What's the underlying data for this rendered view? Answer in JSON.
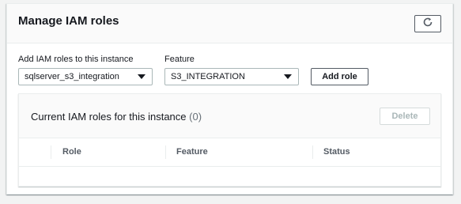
{
  "panel": {
    "title": "Manage IAM roles",
    "refresh_icon": "refresh-icon"
  },
  "form": {
    "role_label": "Add IAM roles to this instance",
    "role_value": "sqlserver_s3_integration",
    "feature_label": "Feature",
    "feature_value": "S3_INTEGRATION",
    "add_button": "Add role"
  },
  "roles_table": {
    "title": "Current IAM roles for this instance",
    "count": "(0)",
    "delete_button": "Delete",
    "columns": [
      "Role",
      "Feature",
      "Status"
    ]
  }
}
